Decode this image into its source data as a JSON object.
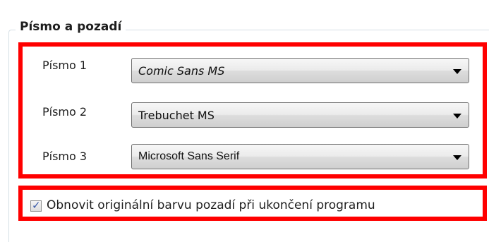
{
  "group": {
    "title": "Písmo a pozadí"
  },
  "fonts": [
    {
      "label": "Písmo 1",
      "value": "Comic Sans MS"
    },
    {
      "label": "Písmo 2",
      "value": "Trebuchet MS"
    },
    {
      "label": "Písmo 3",
      "value": "Microsoft Sans Serif"
    }
  ],
  "restore_background": {
    "label": "Obnovit originální barvu pozadí při ukončení programu",
    "checked": true
  },
  "colors": {
    "highlight": "#ff0000",
    "checkmark": "#3a5aa8"
  },
  "icons": {
    "dropdown": "chevron-down-icon",
    "check": "checkmark-icon"
  }
}
